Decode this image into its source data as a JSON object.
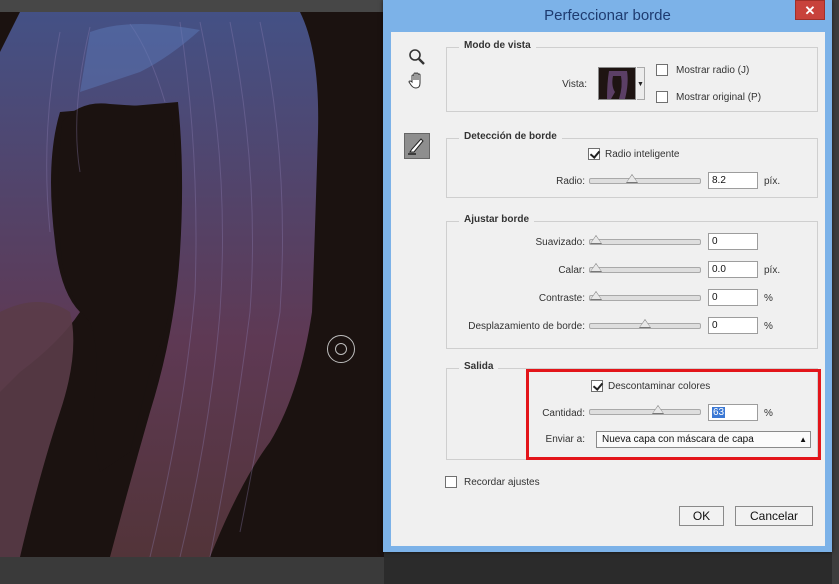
{
  "dialog": {
    "title": "Perfeccionar borde",
    "close_label": "✕"
  },
  "tools": [
    {
      "name": "zoom-tool-icon"
    },
    {
      "name": "hand-tool-icon"
    },
    {
      "name": "refine-radius-tool-icon"
    }
  ],
  "view_mode": {
    "legend": "Modo de vista",
    "vista_label": "Vista:",
    "show_radius_label": "Mostrar radio (J)",
    "show_radius_checked": false,
    "show_original_label": "Mostrar original (P)",
    "show_original_checked": false
  },
  "edge_detection": {
    "legend": "Detección de borde",
    "smart_radius_label": "Radio inteligente",
    "smart_radius_checked": true,
    "radius_label": "Radio:",
    "radius_value": "8.2",
    "radius_unit": "píx.",
    "radius_slider_fraction": 0.37
  },
  "adjust_edge": {
    "legend": "Ajustar borde",
    "rows": [
      {
        "label": "Suavizado:",
        "value": "0",
        "unit": "",
        "fraction": 0.0
      },
      {
        "label": "Calar:",
        "value": "0.0",
        "unit": "píx.",
        "fraction": 0.0
      },
      {
        "label": "Contraste:",
        "value": "0",
        "unit": "%",
        "fraction": 0.0
      },
      {
        "label": "Desplazamiento de borde:",
        "value": "0",
        "unit": "%",
        "fraction": 0.5
      }
    ]
  },
  "output": {
    "legend": "Salida",
    "decontaminate_label": "Descontaminar colores",
    "decontaminate_checked": true,
    "amount_label": "Cantidad:",
    "amount_value": "63",
    "amount_unit": "%",
    "amount_slider_fraction": 0.63,
    "send_to_label": "Enviar a:",
    "send_to_value": "Nueva capa con máscara de capa"
  },
  "remember_label": "Recordar ajustes",
  "remember_checked": false,
  "buttons": {
    "ok": "OK",
    "cancel": "Cancelar"
  },
  "colors": {
    "title_bar": "#7cb2e8",
    "highlight": "#e3151a",
    "close": "#c8423b"
  }
}
